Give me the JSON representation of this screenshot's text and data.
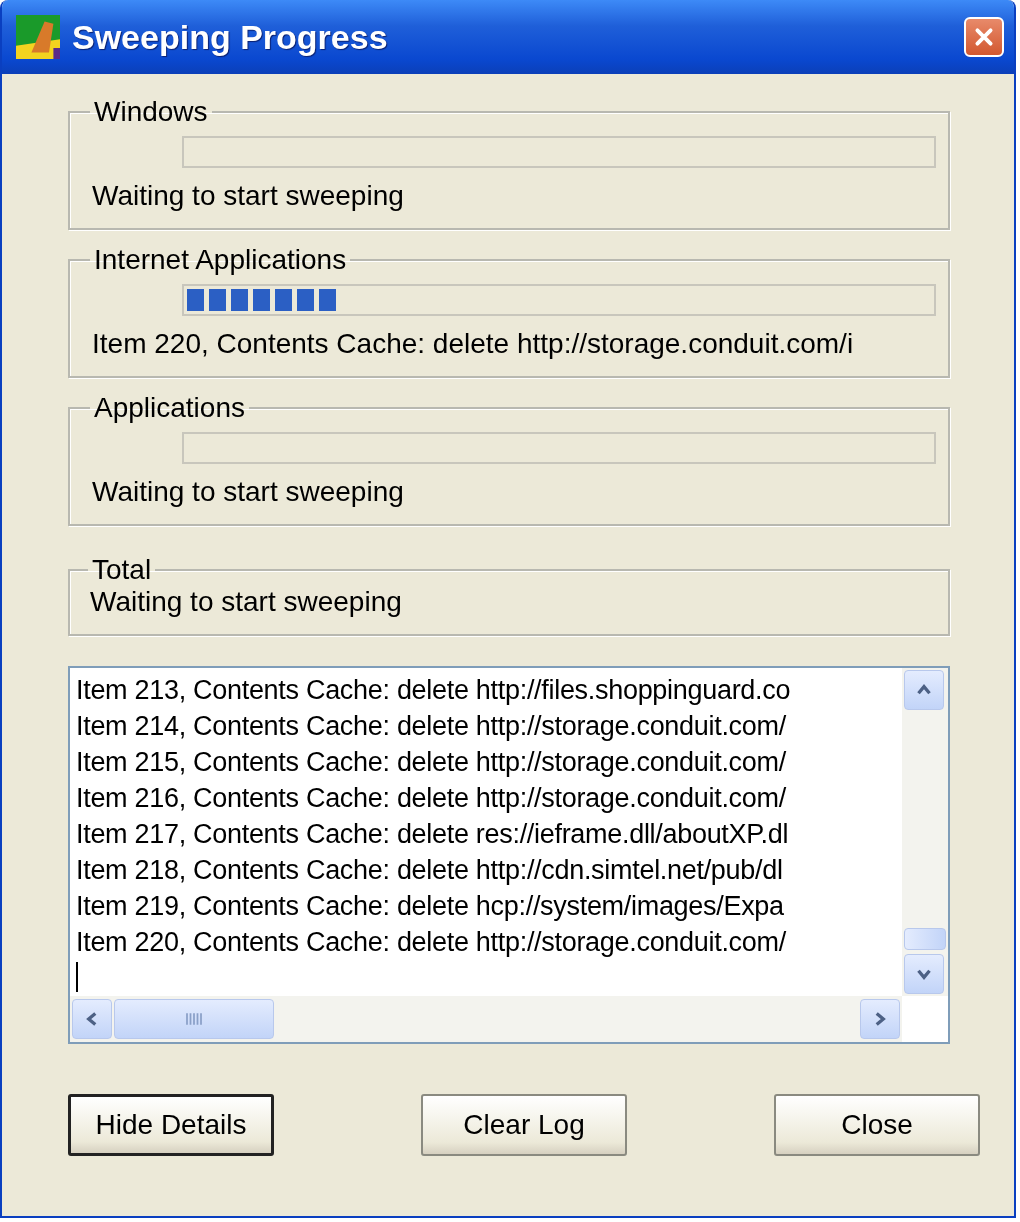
{
  "window": {
    "title": "Sweeping Progress"
  },
  "sections": [
    {
      "kind": "bar",
      "title": "Windows",
      "status": "Waiting to start sweeping"
    },
    {
      "kind": "bar",
      "title": "Internet Applications",
      "level": 0.2,
      "status": "Item 220, Contents Cache: delete http://storage.conduit.com/i"
    },
    {
      "kind": "bar",
      "title": "Applications",
      "status": "Waiting to start sweeping"
    },
    {
      "kind": "text",
      "title": "Total",
      "status": "Waiting to start sweeping"
    }
  ],
  "log": {
    "lines": [
      "Item 213, Contents Cache: delete http://files.shoppinguard.co",
      "Item 214, Contents Cache: delete http://storage.conduit.com/",
      "Item 215, Contents Cache: delete http://storage.conduit.com/",
      "Item 216, Contents Cache: delete http://storage.conduit.com/",
      "Item 217, Contents Cache: delete res://ieframe.dll/aboutXP.dl",
      "Item 218, Contents Cache: delete http://cdn.simtel.net/pub/dl",
      "Item 219, Contents Cache: delete hcp://system/images/Expa",
      "Item 220, Contents Cache: delete http://storage.conduit.com/"
    ]
  },
  "buttons": [
    {
      "label": "Hide Details",
      "default": true
    },
    {
      "label": "Clear Log",
      "default": false
    },
    {
      "label": "Close",
      "default": false
    }
  ]
}
